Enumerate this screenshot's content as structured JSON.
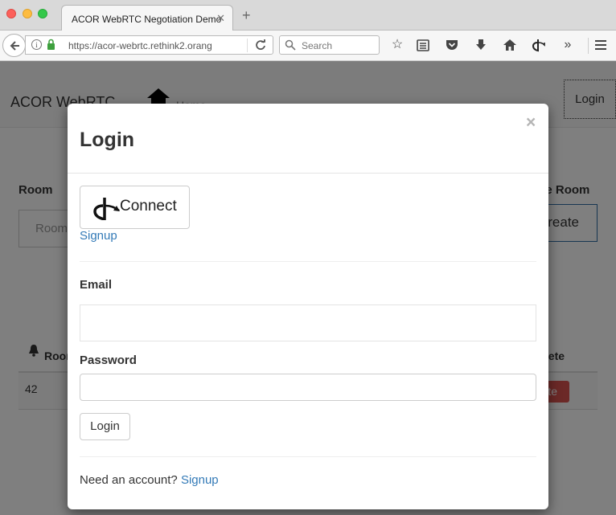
{
  "browser": {
    "tab_title": "ACOR WebRTC Negotiation Demo",
    "tab_close": "✕",
    "new_tab": "+",
    "url": "https://acor-webrtc.rethink2.orang",
    "search_placeholder": "Search",
    "icons": [
      "back-icon",
      "info-icon",
      "lock-icon",
      "reload-icon",
      "search-icon",
      "bookmark-star-icon",
      "reading-list-icon",
      "pocket-icon",
      "download-icon",
      "home-icon",
      "openid-icon",
      "overflow-chevron-icon",
      "menu-icon"
    ]
  },
  "site": {
    "brand": "ACOR WebRTC",
    "home_link": "Home",
    "login_nav": "Login",
    "room_label": "Room",
    "room_placeholder": "Room",
    "create_label": "Create Room",
    "create_button": "Create",
    "table_header_room": "Room",
    "table_header_delete": "Delete",
    "rows": [
      {
        "room": "42",
        "delete_label": "Delete"
      }
    ]
  },
  "modal": {
    "title": "Login",
    "close": "×",
    "connect_label": "Connect",
    "signup_link": "Signup",
    "email_label": "Email",
    "email_value": "",
    "password_label": "Password",
    "password_value": "",
    "login_button": "Login",
    "footer_prompt": "Need an account?",
    "footer_signup": "Signup"
  },
  "colors": {
    "link": "#337ab7",
    "danger": "#d9534f",
    "primary_border": "#2e6da4"
  }
}
